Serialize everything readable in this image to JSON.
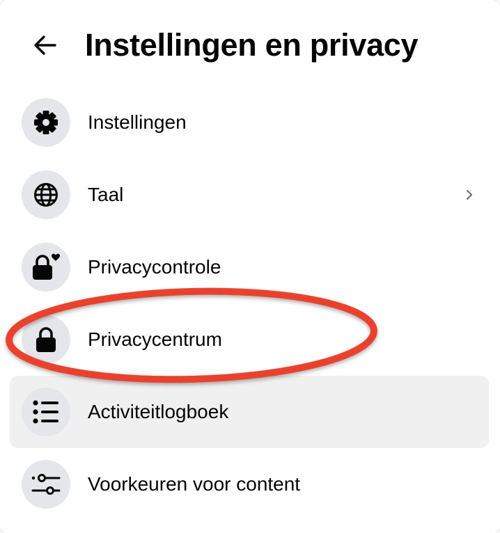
{
  "header": {
    "title": "Instellingen en privacy",
    "back_icon": "arrow-left-icon"
  },
  "menu": {
    "items": [
      {
        "label": "Instellingen",
        "icon": "gear-icon",
        "has_chevron": false,
        "active": false
      },
      {
        "label": "Taal",
        "icon": "globe-icon",
        "has_chevron": true,
        "active": false
      },
      {
        "label": "Privacycontrole",
        "icon": "lock-heart-icon",
        "has_chevron": false,
        "active": false
      },
      {
        "label": "Privacycentrum",
        "icon": "lock-icon",
        "has_chevron": false,
        "active": false,
        "highlighted": true
      },
      {
        "label": "Activiteitlogboek",
        "icon": "list-icon",
        "has_chevron": false,
        "active": true
      },
      {
        "label": "Voorkeuren voor content",
        "icon": "sliders-icon",
        "has_chevron": false,
        "active": false
      }
    ]
  },
  "colors": {
    "text": "#050505",
    "icon_background": "#e4e6eb",
    "active_row_background": "#f0f0f1",
    "annotation_red": "#e8432e"
  }
}
